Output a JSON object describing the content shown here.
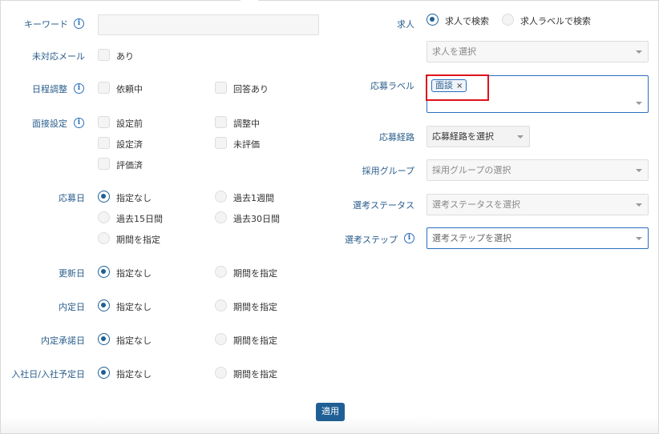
{
  "left": {
    "keyword": {
      "label": "キーワード",
      "value": ""
    },
    "unhandled_mail": {
      "label": "未対応メール",
      "option": "あり"
    },
    "schedule": {
      "label": "日程調整",
      "options": [
        "依頼中",
        "回答あり"
      ]
    },
    "interview_setting": {
      "label": "面接設定",
      "options": [
        "設定前",
        "調整中",
        "設定済",
        "未評価",
        "評価済"
      ]
    },
    "apply_date": {
      "label": "応募日",
      "options": [
        "指定なし",
        "過去1週間",
        "過去15日間",
        "過去30日間",
        "期間を指定"
      ]
    },
    "update_date": {
      "label": "更新日",
      "options": [
        "指定なし",
        "期間を指定"
      ]
    },
    "offer_date": {
      "label": "内定日",
      "options": [
        "指定なし",
        "期間を指定"
      ]
    },
    "offer_accept_date": {
      "label": "内定承諾日",
      "options": [
        "指定なし",
        "期間を指定"
      ]
    },
    "join_date": {
      "label": "入社日/入社予定日",
      "options": [
        "指定なし",
        "期間を指定"
      ]
    }
  },
  "right": {
    "job": {
      "label": "求人",
      "options": [
        "求人で検索",
        "求人ラベルで検索"
      ],
      "select_placeholder": "求人を選択"
    },
    "apply_label": {
      "label": "応募ラベル",
      "tag": "面談",
      "tag_remove": "×"
    },
    "apply_route": {
      "label": "応募経路",
      "placeholder": "応募経路を選択"
    },
    "recruit_group": {
      "label": "採用グループ",
      "placeholder": "採用グループの選択"
    },
    "selection_status": {
      "label": "選考ステータス",
      "placeholder": "選考ステータスを選択"
    },
    "selection_step": {
      "label": "選考ステップ",
      "placeholder": "選考ステップを選択"
    }
  },
  "apply_button": "適用",
  "icons": {
    "info": "i"
  }
}
